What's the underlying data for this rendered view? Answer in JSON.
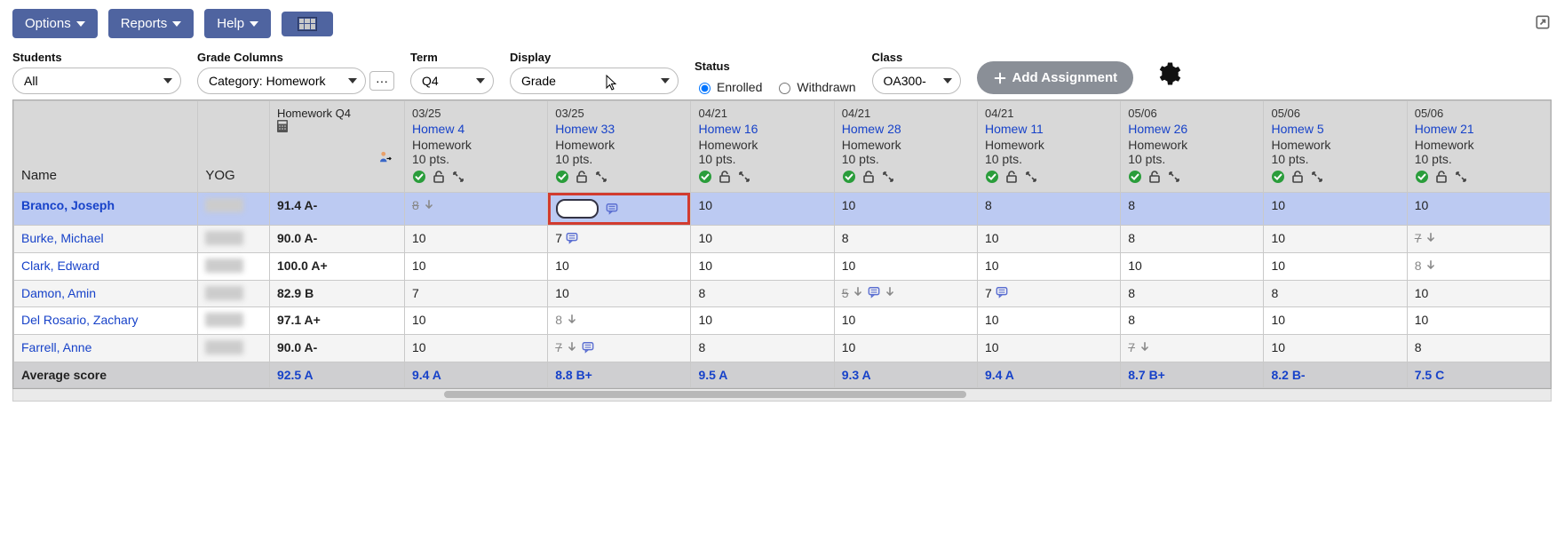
{
  "toolbar": {
    "options_label": "Options",
    "reports_label": "Reports",
    "help_label": "Help"
  },
  "filters": {
    "students": {
      "label": "Students",
      "value": "All"
    },
    "grade_columns": {
      "label": "Grade Columns",
      "value": "Category: Homework"
    },
    "term": {
      "label": "Term",
      "value": "Q4"
    },
    "display": {
      "label": "Display",
      "value": "Grade"
    },
    "status": {
      "label": "Status",
      "enrolled_label": "Enrolled",
      "withdrawn_label": "Withdrawn",
      "selected": "enrolled"
    },
    "class": {
      "label": "Class",
      "value": "OA300-"
    },
    "add_assignment_label": "Add Assignment"
  },
  "columns": {
    "name_header": "Name",
    "yog_header": "YOG",
    "summary_header": "Homework Q4",
    "assignments": [
      {
        "date": "03/25",
        "name": "Homew 4",
        "category": "Homework",
        "points": "10 pts."
      },
      {
        "date": "03/25",
        "name": "Homew 33",
        "category": "Homework",
        "points": "10 pts."
      },
      {
        "date": "04/21",
        "name": "Homew 16",
        "category": "Homework",
        "points": "10 pts."
      },
      {
        "date": "04/21",
        "name": "Homew 28",
        "category": "Homework",
        "points": "10 pts."
      },
      {
        "date": "04/21",
        "name": "Homew 11",
        "category": "Homework",
        "points": "10 pts."
      },
      {
        "date": "05/06",
        "name": "Homew 26",
        "category": "Homework",
        "points": "10 pts."
      },
      {
        "date": "05/06",
        "name": "Homew 5",
        "category": "Homework",
        "points": "10 pts."
      },
      {
        "date": "05/06",
        "name": "Homew 21",
        "category": "Homework",
        "points": "10 pts."
      }
    ]
  },
  "rows": [
    {
      "name": "Branco, Joseph",
      "summary": "91.4 A-",
      "highlight": true,
      "cells": [
        {
          "text": "8",
          "strike": true,
          "gray": true,
          "dropped": true
        },
        {
          "text": "",
          "active_input": true,
          "comment": true
        },
        {
          "text": "10"
        },
        {
          "text": "10"
        },
        {
          "text": "8"
        },
        {
          "text": "8"
        },
        {
          "text": "10"
        },
        {
          "text": "10"
        }
      ]
    },
    {
      "name": "Burke, Michael",
      "summary": "90.0 A-",
      "cells": [
        {
          "text": "10"
        },
        {
          "text": "7",
          "comment": true
        },
        {
          "text": "10"
        },
        {
          "text": "8"
        },
        {
          "text": "10"
        },
        {
          "text": "8"
        },
        {
          "text": "10"
        },
        {
          "text": "7",
          "strike": true,
          "gray": true,
          "dropped": true
        }
      ]
    },
    {
      "name": "Clark, Edward",
      "summary": "100.0 A+",
      "cells": [
        {
          "text": "10"
        },
        {
          "text": "10"
        },
        {
          "text": "10"
        },
        {
          "text": "10"
        },
        {
          "text": "10"
        },
        {
          "text": "10"
        },
        {
          "text": "10"
        },
        {
          "text": "8",
          "gray": true,
          "dropped": true
        }
      ]
    },
    {
      "name": "Damon, Amin",
      "summary": "82.9 B",
      "cells": [
        {
          "text": "7"
        },
        {
          "text": "10"
        },
        {
          "text": "8"
        },
        {
          "text": "5",
          "strike": true,
          "gray": true,
          "dropped": true,
          "comment": true,
          "dropped2": true
        },
        {
          "text": "7",
          "comment": true
        },
        {
          "text": "8"
        },
        {
          "text": "8"
        },
        {
          "text": "10"
        }
      ]
    },
    {
      "name": "Del Rosario, Zachary",
      "summary": "97.1 A+",
      "cells": [
        {
          "text": "10"
        },
        {
          "text": "8",
          "gray": true,
          "dropped": true
        },
        {
          "text": "10"
        },
        {
          "text": "10"
        },
        {
          "text": "10"
        },
        {
          "text": "8"
        },
        {
          "text": "10"
        },
        {
          "text": "10"
        }
      ]
    },
    {
      "name": "Farrell, Anne",
      "summary": "90.0 A-",
      "cells": [
        {
          "text": "10"
        },
        {
          "text": "7",
          "strike": true,
          "gray": true,
          "comment": true,
          "dropped": true
        },
        {
          "text": "8"
        },
        {
          "text": "10"
        },
        {
          "text": "10"
        },
        {
          "text": "7",
          "strike": true,
          "gray": true,
          "dropped": true
        },
        {
          "text": "10"
        },
        {
          "text": "8"
        }
      ]
    }
  ],
  "footer": {
    "label": "Average score",
    "summary": "92.5 A",
    "values": [
      "9.4 A",
      "8.8 B+",
      "9.5 A",
      "9.3 A",
      "9.4 A",
      "8.7 B+",
      "8.2 B-",
      "7.5 C"
    ]
  }
}
